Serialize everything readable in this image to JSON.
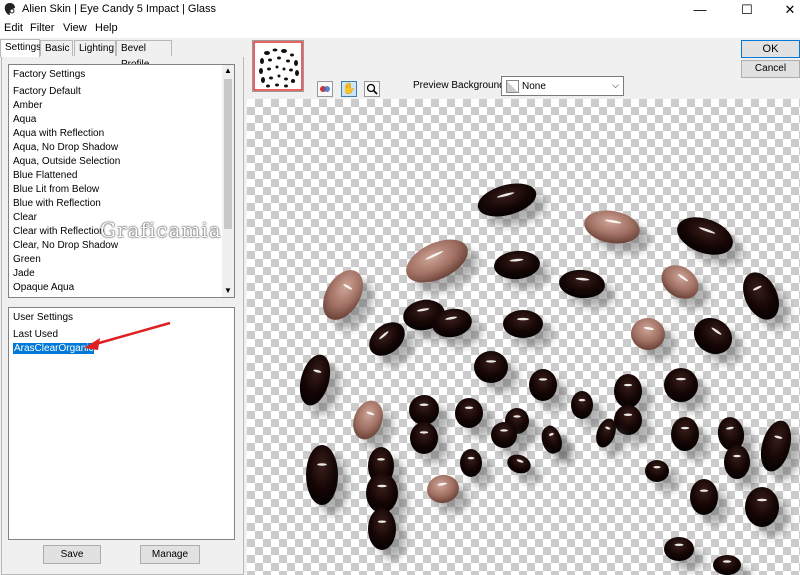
{
  "window": {
    "title": "Alien Skin | Eye Candy 5 Impact | Glass",
    "controls": {
      "minimize": "—",
      "maximize": "☐",
      "close": "✕"
    }
  },
  "menu": {
    "items": [
      "Edit",
      "Filter",
      "View",
      "Help"
    ]
  },
  "tabs": [
    {
      "label": "Settings",
      "active": true
    },
    {
      "label": "Basic",
      "active": false
    },
    {
      "label": "Lighting",
      "active": false
    },
    {
      "label": "Bevel Profile",
      "active": false
    }
  ],
  "factory": {
    "header": "Factory Settings",
    "items": [
      "Factory Default",
      "Amber",
      "Aqua",
      "Aqua with Reflection",
      "Aqua, No Drop Shadow",
      "Aqua, Outside Selection",
      "Blue Flattened",
      "Blue Lit from Below",
      "Blue with Reflection",
      "Clear",
      "Clear with Reflection",
      "Clear, No Drop Shadow",
      "Green",
      "Jade",
      "Opaque Aqua"
    ]
  },
  "user": {
    "header": "User Settings",
    "items": [
      "Last Used",
      "ArasClearOrganic"
    ],
    "selected": "ArasClearOrganic"
  },
  "buttons": {
    "save": "Save",
    "manage": "Manage",
    "ok": "OK",
    "cancel": "Cancel"
  },
  "preview": {
    "background_label": "Preview Background:",
    "background_value": "None"
  },
  "watermark": "Graficamia",
  "colors": {
    "selection": "#0078d7",
    "annotation_arrow": "#e02020",
    "bead_dark": "#1a0a08",
    "bead_light": "#a7766a"
  }
}
